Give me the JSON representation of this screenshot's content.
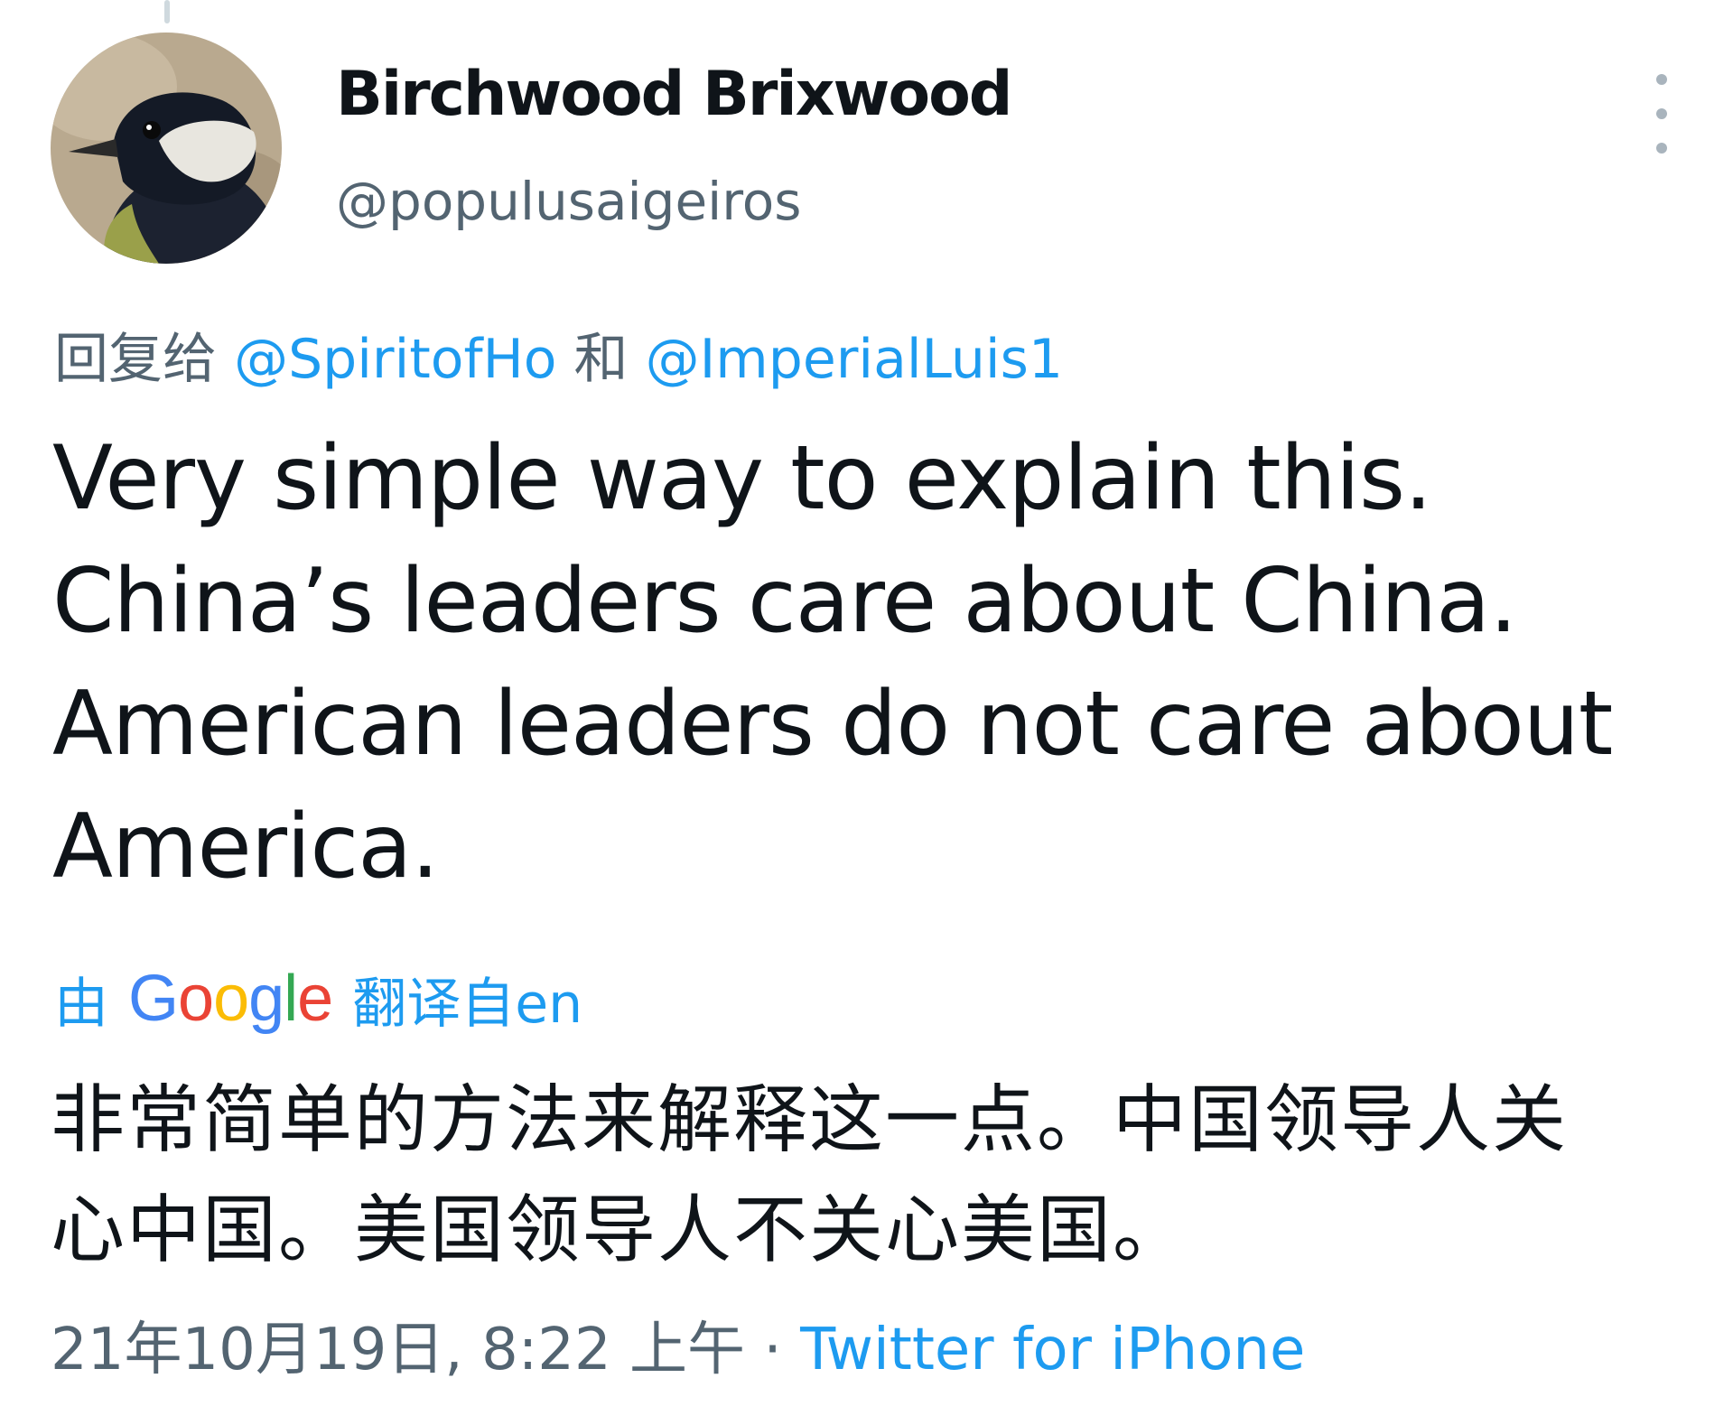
{
  "author": {
    "display_name": "Birchwood Brixwood",
    "handle": "@populusaigeiros"
  },
  "reply": {
    "prefix": "回复给",
    "mention_1": "@SpiritofHo",
    "conjunction": "和",
    "mention_2": "@ImperialLuis1"
  },
  "tweet": {
    "lines": [
      "Very simple way to explain this.",
      "China’s leaders care about China.",
      "American leaders do not care about",
      "America."
    ]
  },
  "translation": {
    "by": "由",
    "google_letters": [
      "G",
      "o",
      "o",
      "g",
      "l",
      "e"
    ],
    "google_colors": [
      "#4285f4",
      "#ea4335",
      "#fbbc05",
      "#4285f4",
      "#34a853",
      "#ea4335"
    ],
    "from_label": "翻译自en",
    "lines": [
      "非常简单的方法来解释这一点。中国领导人关",
      "心中国。美国领导人不关心美国。"
    ]
  },
  "meta": {
    "timestamp": "21年10月19日, 8:22 上午",
    "separator": " · ",
    "source": "Twitter for iPhone"
  },
  "icons": {
    "more": "more-vertical-icon",
    "avatar": "great-tit-bird-avatar"
  },
  "colors": {
    "link": "#1d9bf0",
    "secondary_text": "#536471",
    "primary_text": "#0f1419"
  }
}
